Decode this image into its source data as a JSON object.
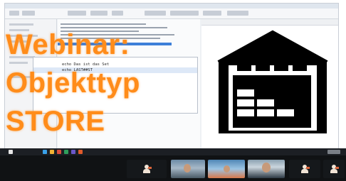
{
  "overlay_title": {
    "line1": "Webinar:",
    "line2": "Objekttyp",
    "line3": "STORE"
  },
  "code_editor": {
    "lines": [
      "echo Das ist das Set",
      "echo LAST##ST"
    ]
  },
  "icon": "warehouse-icon",
  "colors": {
    "title": "#ff8c1a",
    "icon": "#000000",
    "taskbar": "#1c1f24",
    "callbar": "#101214"
  },
  "participants": [
    {
      "kind": "avatar"
    },
    {
      "kind": "camera"
    },
    {
      "kind": "camera"
    },
    {
      "kind": "camera"
    },
    {
      "kind": "avatar"
    },
    {
      "kind": "avatar"
    }
  ]
}
